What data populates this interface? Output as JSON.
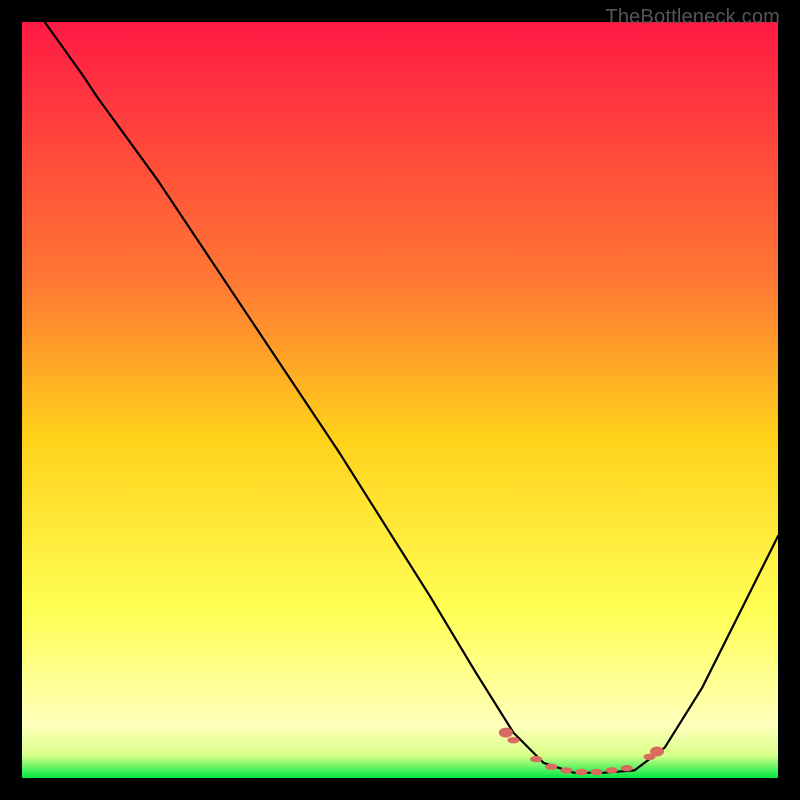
{
  "watermark": "TheBottleneck.com",
  "chart_data": {
    "type": "line",
    "title": "",
    "xlabel": "",
    "ylabel": "",
    "x_range": [
      0,
      100
    ],
    "y_range": [
      0,
      100
    ],
    "gradient_stops": [
      {
        "offset": 0,
        "color": "#ff1a44"
      },
      {
        "offset": 35,
        "color": "#ff7a33"
      },
      {
        "offset": 55,
        "color": "#ffd21a"
      },
      {
        "offset": 78,
        "color": "#ffff55"
      },
      {
        "offset": 93,
        "color": "#ffffbb"
      },
      {
        "offset": 97,
        "color": "#d8ff88"
      },
      {
        "offset": 100,
        "color": "#00e845"
      }
    ],
    "series": [
      {
        "name": "bottleneck-curve",
        "color": "#000000",
        "points": [
          {
            "x": 3,
            "y": 100
          },
          {
            "x": 8,
            "y": 93
          },
          {
            "x": 10,
            "y": 90
          },
          {
            "x": 18,
            "y": 79
          },
          {
            "x": 30,
            "y": 61
          },
          {
            "x": 42,
            "y": 43
          },
          {
            "x": 54,
            "y": 24
          },
          {
            "x": 60,
            "y": 14
          },
          {
            "x": 65,
            "y": 6
          },
          {
            "x": 69,
            "y": 2
          },
          {
            "x": 73,
            "y": 0.7
          },
          {
            "x": 77,
            "y": 0.7
          },
          {
            "x": 81,
            "y": 1.0
          },
          {
            "x": 85,
            "y": 4
          },
          {
            "x": 90,
            "y": 12
          },
          {
            "x": 96,
            "y": 24
          },
          {
            "x": 100,
            "y": 32
          }
        ]
      }
    ],
    "markers": {
      "name": "highlight-dots",
      "color": "#d86a60",
      "radius": 6,
      "points": [
        {
          "x": 64,
          "y": 6
        },
        {
          "x": 65,
          "y": 5
        },
        {
          "x": 68,
          "y": 2.5
        },
        {
          "x": 70,
          "y": 1.5
        },
        {
          "x": 72,
          "y": 1.0
        },
        {
          "x": 74,
          "y": 0.8
        },
        {
          "x": 76,
          "y": 0.8
        },
        {
          "x": 78,
          "y": 1.0
        },
        {
          "x": 80,
          "y": 1.3
        },
        {
          "x": 83,
          "y": 2.8
        },
        {
          "x": 84,
          "y": 3.5
        }
      ]
    }
  }
}
